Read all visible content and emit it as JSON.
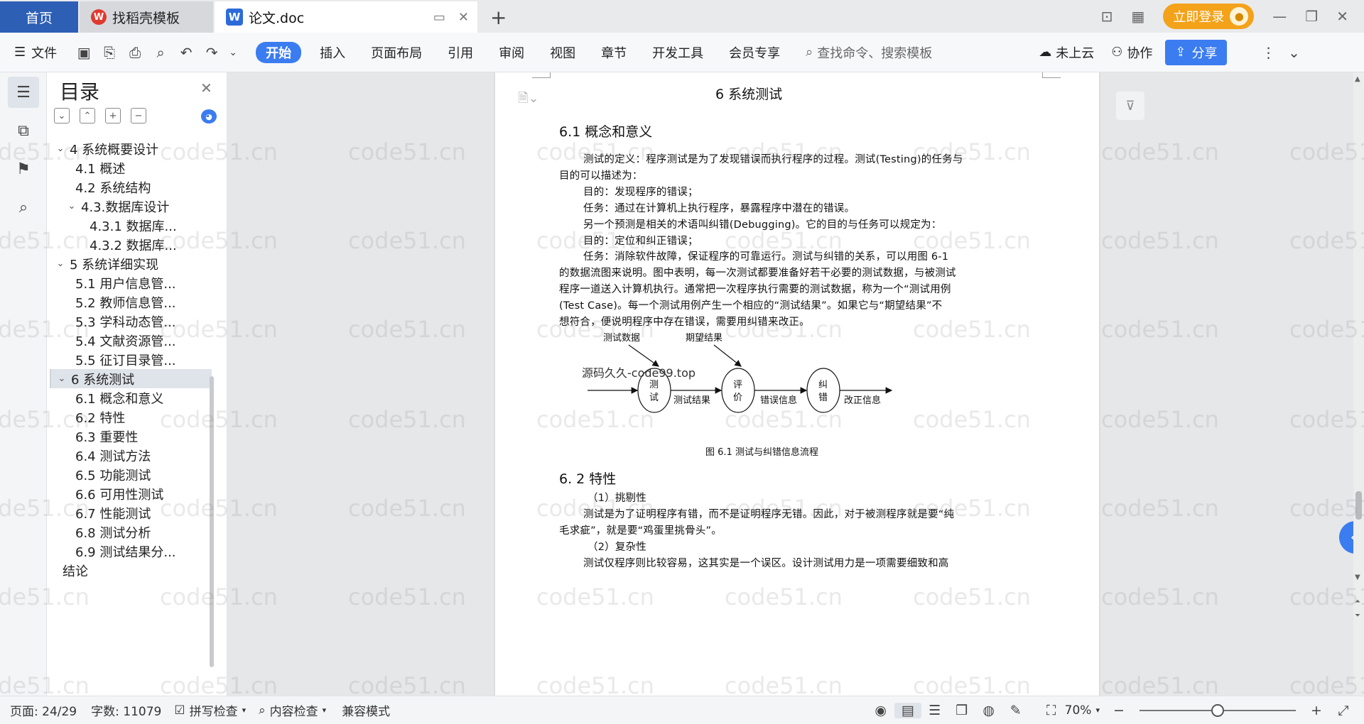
{
  "titlebar": {
    "tabs": [
      {
        "label": "首页"
      },
      {
        "label": "找稻壳模板",
        "icon": "daoke-logo-icon"
      },
      {
        "label": "论文.doc",
        "icon": "wps-writer-icon"
      }
    ],
    "login_label": "立即登录"
  },
  "toolbar": {
    "file_label": "文件",
    "tabs": [
      "开始",
      "插入",
      "页面布局",
      "引用",
      "审阅",
      "视图",
      "章节",
      "开发工具",
      "会员专享"
    ],
    "search_placeholder": "查找命令、搜索模板",
    "cloud_label": "未上云",
    "collab_label": "协作",
    "share_label": "分享",
    "accent_color": "#3b7cf0"
  },
  "toc": {
    "title": "目录",
    "items": [
      {
        "level": 1,
        "label": "4 系统概要设计",
        "caret": "open"
      },
      {
        "level": 2,
        "label": "4.1 概述"
      },
      {
        "level": 2,
        "label": "4.2 系统结构"
      },
      {
        "level": 2,
        "label": "4.3.数据库设计",
        "caret": "open"
      },
      {
        "level": 3,
        "label": "4.3.1 数据库..."
      },
      {
        "level": 3,
        "label": "4.3.2 数据库..."
      },
      {
        "level": 1,
        "label": "5 系统详细实现",
        "caret": "open"
      },
      {
        "level": 2,
        "label": "5.1  用户信息管..."
      },
      {
        "level": 2,
        "label": "5.2  教师信息管..."
      },
      {
        "level": 2,
        "label": "5.3  学科动态管..."
      },
      {
        "level": 2,
        "label": "5.4  文献资源管..."
      },
      {
        "level": 2,
        "label": "5.5  征订目录管..."
      },
      {
        "level": 1,
        "label": "6 系统测试",
        "caret": "open",
        "selected": true
      },
      {
        "level": 2,
        "label": "6.1 概念和意义"
      },
      {
        "level": 2,
        "label": "6.2 特性"
      },
      {
        "level": 2,
        "label": "6.3 重要性"
      },
      {
        "level": 2,
        "label": "6.4 测试方法"
      },
      {
        "level": 2,
        "label": "6.5  功能测试"
      },
      {
        "level": 2,
        "label": "6.6 可用性测试"
      },
      {
        "level": 2,
        "label": "6.7 性能测试"
      },
      {
        "level": 2,
        "label": "6.8 测试分析"
      },
      {
        "level": 2,
        "label": "6.9 测试结果分..."
      },
      {
        "level": 1,
        "label": "结论",
        "caret": "none"
      }
    ]
  },
  "document": {
    "chapter_title": "6 系统测试",
    "sec1_title": "6.1 概念和意义",
    "lines": [
      "测试的定义：程序测试是为了发现错误而执行程序的过程。测试(Testing)的任务与",
      "目的可以描述为：",
      "目的：发现程序的错误；",
      "任务：通过在计算机上执行程序，暴露程序中潜在的错误。",
      "另一个预测是相关的术语叫纠错(Debugging)。它的目的与任务可以规定为：",
      "目的：定位和纠正错误；",
      "任务：消除软件故障，保证程序的可靠运行。测试与纠错的关系，可以用图 6-1",
      "的数据流图来说明。图中表明，每一次测试都要准备好若干必要的测试数据，与被测试",
      "程序一道送入计算机执行。通常把一次程序执行需要的测试数据，称为一个“测试用例",
      "(Test Case)。每一个测试用例产生一个相应的“测试结果”。如果它与“期望结果”不",
      "想符合，便说明程序中存在错误，需要用纠错来改正。"
    ],
    "overlay_text": "源码久久-code99.top",
    "diagram": {
      "label_test_data": "测试数据",
      "label_expected": "期望结果",
      "node_test": [
        "测",
        "试"
      ],
      "node_eval": [
        "评",
        "价"
      ],
      "node_fix": [
        "纠",
        "错"
      ],
      "edge_result": "测试结果",
      "edge_error": "错误信息",
      "edge_fix": "改正信息",
      "caption": "图 6.1 测试与纠错信息流程"
    },
    "sec2_title": "6. 2 特性",
    "lines2": [
      "（1）挑剔性",
      "测试是为了证明程序有错，而不是证明程序无错。因此，对于被测程序就是要“纯",
      "毛求疵”，就是要“鸡蛋里挑骨头”。",
      "（2）复杂性",
      "测试仅程序则比较容易，这其实是一个误区。设计测试用力是一项需要细致和高"
    ]
  },
  "watermark_text": "code51.cn",
  "status": {
    "page": "页面: 24/29",
    "words": "字数: 11079",
    "spell": "拼写检查",
    "content_check": "内容检查",
    "compat": "兼容模式",
    "zoom": "70%",
    "zoom_level": 0.5
  }
}
